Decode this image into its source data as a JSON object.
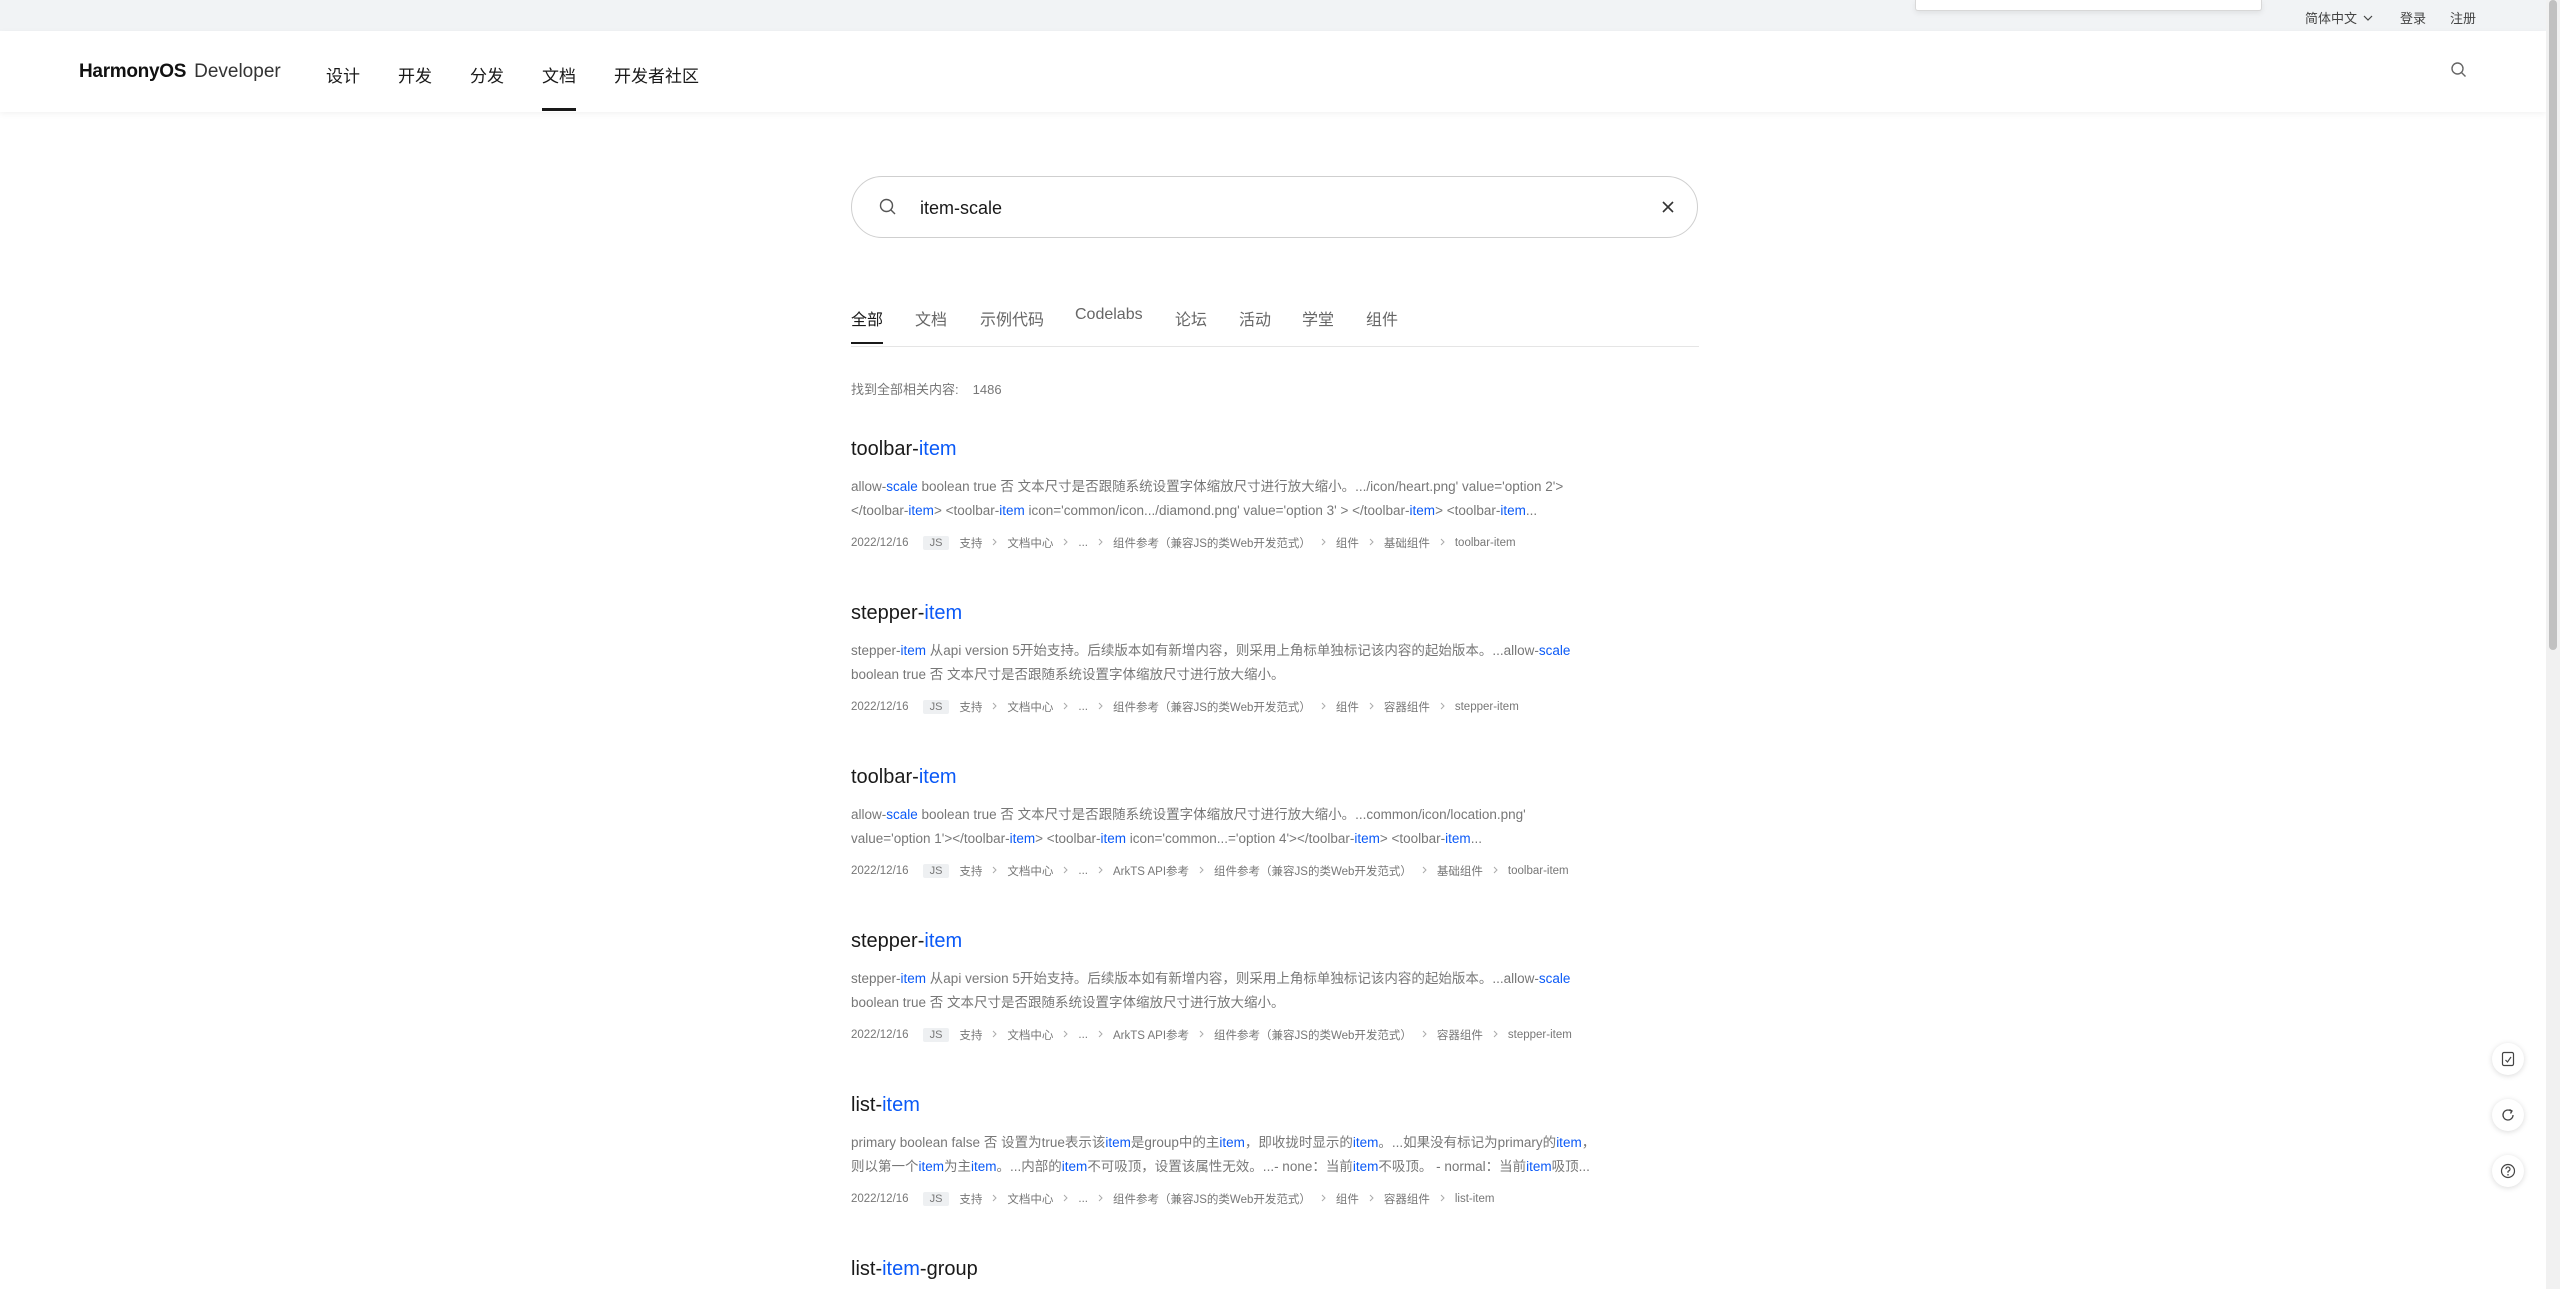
{
  "topbar": {
    "language": "简体中文",
    "login": "登录",
    "register": "注册"
  },
  "header": {
    "logo_brand": "HarmonyOS",
    "logo_sub": "Developer",
    "nav": [
      "设计",
      "开发",
      "分发",
      "文档",
      "开发者社区"
    ],
    "active_nav": "文档"
  },
  "search": {
    "value": "item-scale"
  },
  "tabs": [
    "全部",
    "文档",
    "示例代码",
    "Codelabs",
    "论坛",
    "活动",
    "学堂",
    "组件"
  ],
  "active_tab": "全部",
  "results_count": {
    "label": "找到全部相关内容:",
    "value": "1486"
  },
  "results": [
    {
      "title_prefix": "toolbar-",
      "title_hl": "item",
      "title_suffix": "",
      "snippet_line1": [
        {
          "t": "allow-",
          "h": false
        },
        {
          "t": "scale",
          "h": true
        },
        {
          "t": " boolean true 否 文本尺寸是否跟随系统设置字体缩放尺寸进行放大缩小。.../icon/heart.png' value='option 2'>",
          "h": false
        }
      ],
      "snippet_line2": [
        {
          "t": "</toolbar-",
          "h": false
        },
        {
          "t": "item",
          "h": true
        },
        {
          "t": "> <toolbar-",
          "h": false
        },
        {
          "t": "item",
          "h": true
        },
        {
          "t": " icon='common/icon.../diamond.png' value='option 3' > </toolbar-",
          "h": false
        },
        {
          "t": "item",
          "h": true
        },
        {
          "t": "> <toolbar-",
          "h": false
        },
        {
          "t": "item",
          "h": true
        },
        {
          "t": "...",
          "h": false
        }
      ],
      "date": "2022/12/16",
      "tag": "JS",
      "crumbs": [
        "支持",
        "文档中心",
        "...",
        "组件参考（兼容JS的类Web开发范式）",
        "组件",
        "基础组件",
        "toolbar-item"
      ]
    },
    {
      "title_prefix": "stepper-",
      "title_hl": "item",
      "title_suffix": "",
      "snippet_line1": [
        {
          "t": "stepper-",
          "h": false
        },
        {
          "t": "item",
          "h": true
        },
        {
          "t": " 从api version 5开始支持。后续版本如有新增内容，则采用上角标单独标记该内容的起始版本。...allow-",
          "h": false
        },
        {
          "t": "scale",
          "h": true
        }
      ],
      "snippet_line2": [
        {
          "t": "boolean true 否 文本尺寸是否跟随系统设置字体缩放尺寸进行放大缩小。",
          "h": false
        }
      ],
      "date": "2022/12/16",
      "tag": "JS",
      "crumbs": [
        "支持",
        "文档中心",
        "...",
        "组件参考（兼容JS的类Web开发范式）",
        "组件",
        "容器组件",
        "stepper-item"
      ]
    },
    {
      "title_prefix": "toolbar-",
      "title_hl": "item",
      "title_suffix": "",
      "snippet_line1": [
        {
          "t": "allow-",
          "h": false
        },
        {
          "t": "scale",
          "h": true
        },
        {
          "t": " boolean true 否 文本尺寸是否跟随系统设置字体缩放尺寸进行放大缩小。...common/icon/location.png'",
          "h": false
        }
      ],
      "snippet_line2": [
        {
          "t": "value='option 1'></toolbar-",
          "h": false
        },
        {
          "t": "item",
          "h": true
        },
        {
          "t": "> <toolbar-",
          "h": false
        },
        {
          "t": "item",
          "h": true
        },
        {
          "t": " icon='common...='option 4'></toolbar-",
          "h": false
        },
        {
          "t": "item",
          "h": true
        },
        {
          "t": "> <toolbar-",
          "h": false
        },
        {
          "t": "item",
          "h": true
        },
        {
          "t": "...",
          "h": false
        }
      ],
      "date": "2022/12/16",
      "tag": "JS",
      "crumbs": [
        "支持",
        "文档中心",
        "...",
        "ArkTS API参考",
        "组件参考（兼容JS的类Web开发范式）",
        "基础组件",
        "toolbar-item"
      ]
    },
    {
      "title_prefix": "stepper-",
      "title_hl": "item",
      "title_suffix": "",
      "snippet_line1": [
        {
          "t": "stepper-",
          "h": false
        },
        {
          "t": "item",
          "h": true
        },
        {
          "t": " 从api version 5开始支持。后续版本如有新增内容，则采用上角标单独标记该内容的起始版本。...allow-",
          "h": false
        },
        {
          "t": "scale",
          "h": true
        }
      ],
      "snippet_line2": [
        {
          "t": "boolean true 否 文本尺寸是否跟随系统设置字体缩放尺寸进行放大缩小。",
          "h": false
        }
      ],
      "date": "2022/12/16",
      "tag": "JS",
      "crumbs": [
        "支持",
        "文档中心",
        "...",
        "ArkTS API参考",
        "组件参考（兼容JS的类Web开发范式）",
        "容器组件",
        "stepper-item"
      ]
    },
    {
      "title_prefix": "list-",
      "title_hl": "item",
      "title_suffix": "",
      "snippet_line1": [
        {
          "t": "primary boolean false 否 设置为true表示该",
          "h": false
        },
        {
          "t": "item",
          "h": true
        },
        {
          "t": "是group中的主",
          "h": false
        },
        {
          "t": "item",
          "h": true
        },
        {
          "t": "，即收拢时显示的",
          "h": false
        },
        {
          "t": "item",
          "h": true
        },
        {
          "t": "。...如果没有标记为primary的",
          "h": false
        },
        {
          "t": "item",
          "h": true
        },
        {
          "t": "，",
          "h": false
        }
      ],
      "snippet_line2": [
        {
          "t": "则以第一个",
          "h": false
        },
        {
          "t": "item",
          "h": true
        },
        {
          "t": "为主",
          "h": false
        },
        {
          "t": "item",
          "h": true
        },
        {
          "t": "。...内部的",
          "h": false
        },
        {
          "t": "item",
          "h": true
        },
        {
          "t": "不可吸顶，设置该属性无效。...- none：当前",
          "h": false
        },
        {
          "t": "item",
          "h": true
        },
        {
          "t": "不吸顶。 - normal：当前",
          "h": false
        },
        {
          "t": "item",
          "h": true
        },
        {
          "t": "吸顶...",
          "h": false
        }
      ],
      "date": "2022/12/16",
      "tag": "JS",
      "crumbs": [
        "支持",
        "文档中心",
        "...",
        "组件参考（兼容JS的类Web开发范式）",
        "组件",
        "容器组件",
        "list-item"
      ]
    },
    {
      "title_prefix": "list-",
      "title_hl": "item",
      "title_suffix": "-group"
    }
  ],
  "float_buttons": [
    "feedback-icon",
    "refresh-icon",
    "help-icon"
  ],
  "colors": {
    "highlight": "#0a59f7",
    "text": "#191919",
    "muted": "#777777"
  }
}
